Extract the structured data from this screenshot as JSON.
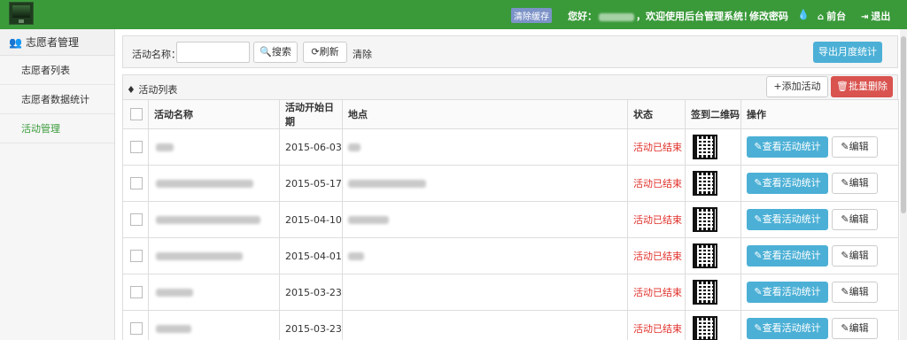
{
  "topbar": {
    "clear_cache": "清除缓存",
    "greeting_prefix": "您好：",
    "greeting_suffix": "，欢迎使用后台管理系统！",
    "change_password": "修改密码",
    "frontend": "前台",
    "logout": "退出"
  },
  "sidebar": {
    "section_title": "志愿者管理",
    "items": [
      {
        "label": "志愿者列表"
      },
      {
        "label": "志愿者数据统计"
      },
      {
        "label": "活动管理"
      }
    ]
  },
  "search": {
    "label": "活动名称：",
    "search_button": "搜索",
    "refresh_button": "刷新",
    "clear_link": "清除",
    "export_button": "导出月度统计"
  },
  "list": {
    "title": "活动列表",
    "add_button": "添加活动",
    "batch_delete_button": "批量删除",
    "columns": {
      "name": "活动名称",
      "start_date": "活动开始日期",
      "location": "地点",
      "status": "状态",
      "qr": "签到二维码",
      "actions": "操作"
    },
    "rows": [
      {
        "start_date": "2015-06-03",
        "status": "活动已结束",
        "stats_button": "查看活动统计",
        "edit_button": "编辑"
      },
      {
        "start_date": "2015-05-17",
        "status": "活动已结束",
        "stats_button": "查看活动统计",
        "edit_button": "编辑"
      },
      {
        "start_date": "2015-04-10",
        "status": "活动已结束",
        "stats_button": "查看活动统计",
        "edit_button": "编辑"
      },
      {
        "start_date": "2015-04-01",
        "status": "活动已结束",
        "stats_button": "查看活动统计",
        "edit_button": "编辑"
      },
      {
        "start_date": "2015-03-23",
        "status": "活动已结束",
        "stats_button": "查看活动统计",
        "edit_button": "编辑"
      },
      {
        "start_date": "2015-03-23",
        "status": "活动已结束",
        "stats_button": "查看活动统计",
        "edit_button": "编辑"
      }
    ]
  },
  "colors": {
    "topbar": "#3a9a3a",
    "primary_info": "#4cb0d6",
    "danger": "#d9534f",
    "status_ended": "#e0302a",
    "active_nav": "#3a9a3a"
  }
}
